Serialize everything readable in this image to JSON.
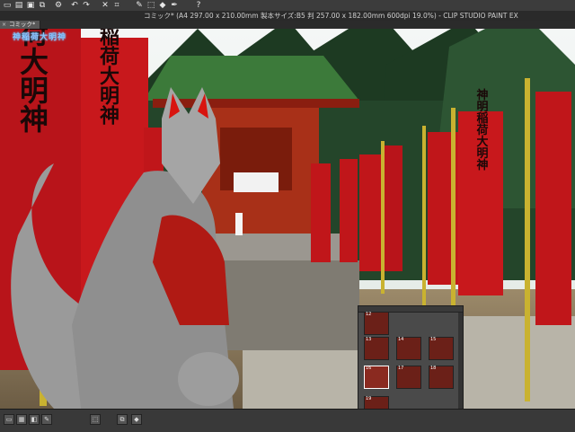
{
  "toolbar": {
    "icons": [
      "new-document-icon",
      "open-file-icon",
      "save-icon",
      "copy-icon",
      "settings-icon",
      "undo-icon",
      "redo-icon",
      "clear-icon",
      "crop-icon",
      "brush-icon",
      "select-icon",
      "fill-icon",
      "pen-icon",
      "help-icon"
    ]
  },
  "window": {
    "title": "コミック* (A4 297.00 x 210.00mm 製本サイズ:B5 判 257.00 x 182.00mm 600dpi 19.0%) - CLIP STUDIO PAINT EX"
  },
  "tab": {
    "label": "コミック*"
  },
  "logo": {
    "text": "神稲荷大明神"
  },
  "banners": {
    "left_text": "神明稲荷大明神",
    "big_left_text": "円稲荷大明神"
  },
  "navigator": {
    "pages": [
      "12",
      "13",
      "14",
      "15",
      "16",
      "17",
      "18",
      "19"
    ],
    "selected_page": "16"
  },
  "colors": {
    "banner_red": "#c0161a",
    "shrine_green": "#3c7a3a",
    "ui_dark": "#2b2b2b"
  }
}
